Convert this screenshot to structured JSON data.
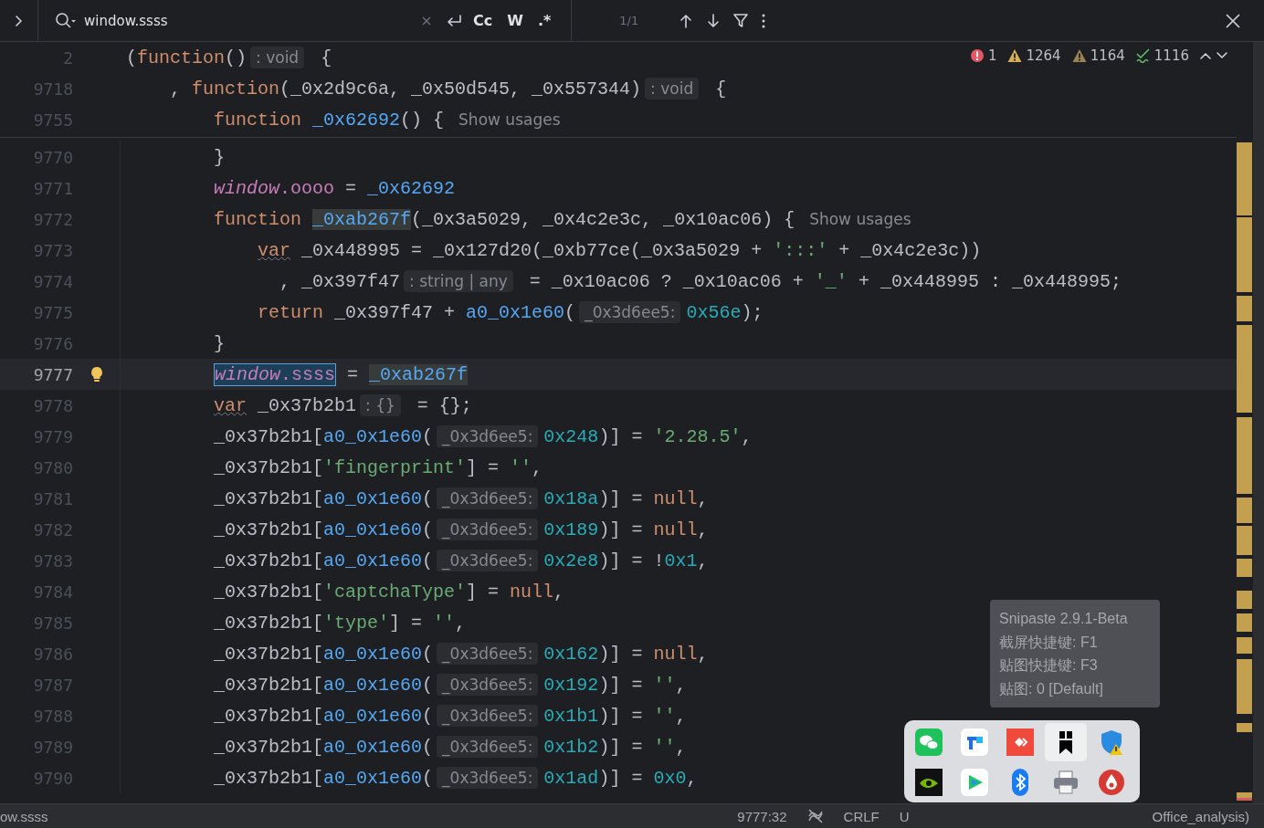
{
  "find_bar": {
    "query": "window.ssss",
    "options": [
      {
        "label": "Cc",
        "selected": false
      },
      {
        "label": "W",
        "selected": false
      },
      {
        "label": ".*",
        "selected": false
      }
    ],
    "count": "1/1"
  },
  "inspections": [
    {
      "kind": "error",
      "count": "1"
    },
    {
      "kind": "warning",
      "count": "1264"
    },
    {
      "kind": "weak",
      "count": "1164"
    },
    {
      "kind": "typo",
      "count": "1116"
    }
  ],
  "sticky_lines": [
    {
      "number": "2",
      "tokens": [
        {
          "kind": "plain",
          "text": "("
        },
        {
          "kind": "kw",
          "text": "function"
        },
        {
          "kind": "plain",
          "text": "()"
        },
        {
          "kind": "hint",
          "text": ": void"
        },
        {
          "kind": "plain",
          "text": " {"
        }
      ]
    },
    {
      "number": "9718",
      "tokens": [
        {
          "kind": "plain",
          "text": "    , "
        },
        {
          "kind": "kw",
          "text": "function"
        },
        {
          "kind": "plain",
          "text": "(_0x2d9c6a, _0x50d545, _0x557344)"
        },
        {
          "kind": "hint",
          "text": ": void"
        },
        {
          "kind": "plain",
          "text": " {"
        }
      ]
    },
    {
      "number": "9755",
      "tokens": [
        {
          "kind": "kw",
          "text": "        function "
        },
        {
          "kind": "decl",
          "text": "_0x62692"
        },
        {
          "kind": "plain",
          "text": "() { "
        },
        {
          "kind": "usage",
          "text": "Show usages"
        }
      ]
    }
  ],
  "lines": [
    {
      "number": "9770",
      "current": false,
      "tokens": [
        {
          "kind": "plain",
          "text": "        }"
        }
      ]
    },
    {
      "number": "9771",
      "current": false,
      "tokens": [
        {
          "kind": "global",
          "text": "        window"
        },
        {
          "kind": "prop",
          "text": ".oooo"
        },
        {
          "kind": "plain",
          "text": " = "
        },
        {
          "kind": "decl",
          "text": "_0x62692"
        }
      ]
    },
    {
      "number": "9772",
      "current": false,
      "tokens": [
        {
          "kind": "kw",
          "text": "        function "
        },
        {
          "kind": "decl",
          "text": "_0xab267f",
          "usage_match": true
        },
        {
          "kind": "plain",
          "text": "(_0x3a5029, _0x4c2e3c, _0x10ac06) { "
        },
        {
          "kind": "usage",
          "text": "Show usages"
        }
      ]
    },
    {
      "number": "9773",
      "current": false,
      "tokens": [
        {
          "kind": "kw",
          "text": "            var",
          "warning": true
        },
        {
          "kind": "plain",
          "text": " _0x448995 = _0x127d20(_0xb77ce(_0x3a5029 + "
        },
        {
          "kind": "str",
          "text": "':::'"
        },
        {
          "kind": "plain",
          "text": " + _0x4c2e3c))"
        }
      ]
    },
    {
      "number": "9774",
      "current": false,
      "tokens": [
        {
          "kind": "plain",
          "text": "              , _0x397f47"
        },
        {
          "kind": "hint",
          "text": ": string | any"
        },
        {
          "kind": "plain",
          "text": " = _0x10ac06 ? _0x10ac06 + "
        },
        {
          "kind": "str",
          "text": "'_'"
        },
        {
          "kind": "plain",
          "text": " + _0x448995 : _0x448995;"
        }
      ]
    },
    {
      "number": "9775",
      "current": false,
      "tokens": [
        {
          "kind": "kw",
          "text": "            return"
        },
        {
          "kind": "plain",
          "text": " _0x397f47 + "
        },
        {
          "kind": "call",
          "text": "a0_0x1e60"
        },
        {
          "kind": "plain",
          "text": "("
        },
        {
          "kind": "hint",
          "text": "_0x3d6ee5:"
        },
        {
          "kind": "num",
          "text": "0x56e"
        },
        {
          "kind": "plain",
          "text": ");"
        }
      ]
    },
    {
      "number": "9776",
      "current": false,
      "tokens": [
        {
          "kind": "plain",
          "text": "        }"
        }
      ]
    },
    {
      "number": "9777",
      "current": true,
      "tokens": [
        {
          "kind": "global",
          "text": "        window",
          "search_match": true
        },
        {
          "kind": "prop",
          "text": ".ssss",
          "search_match": true
        },
        {
          "kind": "plain",
          "text": " = "
        },
        {
          "kind": "decl",
          "text": "_0xab267f",
          "usage_match": true
        }
      ]
    },
    {
      "number": "9778",
      "current": false,
      "tokens": [
        {
          "kind": "kw",
          "text": "        var",
          "warning": true
        },
        {
          "kind": "plain",
          "text": " _0x37b2b1"
        },
        {
          "kind": "hint",
          "text": ": {}"
        },
        {
          "kind": "plain",
          "text": " = {};"
        }
      ]
    },
    {
      "number": "9779",
      "current": false,
      "tokens": [
        {
          "kind": "plain",
          "text": "        _0x37b2b1["
        },
        {
          "kind": "call",
          "text": "a0_0x1e60"
        },
        {
          "kind": "plain",
          "text": "("
        },
        {
          "kind": "hint",
          "text": "_0x3d6ee5:"
        },
        {
          "kind": "num",
          "text": "0x248"
        },
        {
          "kind": "plain",
          "text": ")] = "
        },
        {
          "kind": "str",
          "text": "'2.28.5'"
        },
        {
          "kind": "plain",
          "text": ","
        }
      ]
    },
    {
      "number": "9780",
      "current": false,
      "tokens": [
        {
          "kind": "plain",
          "text": "        _0x37b2b1["
        },
        {
          "kind": "str",
          "text": "'fingerprint'"
        },
        {
          "kind": "plain",
          "text": "] = "
        },
        {
          "kind": "str",
          "text": "''"
        },
        {
          "kind": "plain",
          "text": ","
        }
      ]
    },
    {
      "number": "9781",
      "current": false,
      "tokens": [
        {
          "kind": "plain",
          "text": "        _0x37b2b1["
        },
        {
          "kind": "call",
          "text": "a0_0x1e60"
        },
        {
          "kind": "plain",
          "text": "("
        },
        {
          "kind": "hint",
          "text": "_0x3d6ee5:"
        },
        {
          "kind": "num",
          "text": "0x18a"
        },
        {
          "kind": "plain",
          "text": ")] = "
        },
        {
          "kind": "kw",
          "text": "null"
        },
        {
          "kind": "plain",
          "text": ","
        }
      ]
    },
    {
      "number": "9782",
      "current": false,
      "tokens": [
        {
          "kind": "plain",
          "text": "        _0x37b2b1["
        },
        {
          "kind": "call",
          "text": "a0_0x1e60"
        },
        {
          "kind": "plain",
          "text": "("
        },
        {
          "kind": "hint",
          "text": "_0x3d6ee5:"
        },
        {
          "kind": "num",
          "text": "0x189"
        },
        {
          "kind": "plain",
          "text": ")] = "
        },
        {
          "kind": "kw",
          "text": "null"
        },
        {
          "kind": "plain",
          "text": ","
        }
      ]
    },
    {
      "number": "9783",
      "current": false,
      "tokens": [
        {
          "kind": "plain",
          "text": "        _0x37b2b1["
        },
        {
          "kind": "call",
          "text": "a0_0x1e60"
        },
        {
          "kind": "plain",
          "text": "("
        },
        {
          "kind": "hint",
          "text": "_0x3d6ee5:"
        },
        {
          "kind": "num",
          "text": "0x2e8"
        },
        {
          "kind": "plain",
          "text": ")] = !"
        },
        {
          "kind": "num",
          "text": "0x1"
        },
        {
          "kind": "plain",
          "text": ","
        }
      ]
    },
    {
      "number": "9784",
      "current": false,
      "tokens": [
        {
          "kind": "plain",
          "text": "        _0x37b2b1["
        },
        {
          "kind": "str",
          "text": "'captchaType'"
        },
        {
          "kind": "plain",
          "text": "] = "
        },
        {
          "kind": "kw",
          "text": "null"
        },
        {
          "kind": "plain",
          "text": ","
        }
      ]
    },
    {
      "number": "9785",
      "current": false,
      "tokens": [
        {
          "kind": "plain",
          "text": "        _0x37b2b1["
        },
        {
          "kind": "str",
          "text": "'type'"
        },
        {
          "kind": "plain",
          "text": "] = "
        },
        {
          "kind": "str",
          "text": "''"
        },
        {
          "kind": "plain",
          "text": ","
        }
      ]
    },
    {
      "number": "9786",
      "current": false,
      "tokens": [
        {
          "kind": "plain",
          "text": "        _0x37b2b1["
        },
        {
          "kind": "call",
          "text": "a0_0x1e60"
        },
        {
          "kind": "plain",
          "text": "("
        },
        {
          "kind": "hint",
          "text": "_0x3d6ee5:"
        },
        {
          "kind": "num",
          "text": "0x162"
        },
        {
          "kind": "plain",
          "text": ")] = "
        },
        {
          "kind": "kw",
          "text": "null"
        },
        {
          "kind": "plain",
          "text": ","
        }
      ]
    },
    {
      "number": "9787",
      "current": false,
      "tokens": [
        {
          "kind": "plain",
          "text": "        _0x37b2b1["
        },
        {
          "kind": "call",
          "text": "a0_0x1e60"
        },
        {
          "kind": "plain",
          "text": "("
        },
        {
          "kind": "hint",
          "text": "_0x3d6ee5:"
        },
        {
          "kind": "num",
          "text": "0x192"
        },
        {
          "kind": "plain",
          "text": ")] = "
        },
        {
          "kind": "str",
          "text": "''"
        },
        {
          "kind": "plain",
          "text": ","
        }
      ]
    },
    {
      "number": "9788",
      "current": false,
      "tokens": [
        {
          "kind": "plain",
          "text": "        _0x37b2b1["
        },
        {
          "kind": "call",
          "text": "a0_0x1e60"
        },
        {
          "kind": "plain",
          "text": "("
        },
        {
          "kind": "hint",
          "text": "_0x3d6ee5:"
        },
        {
          "kind": "num",
          "text": "0x1b1"
        },
        {
          "kind": "plain",
          "text": ")] = "
        },
        {
          "kind": "str",
          "text": "''"
        },
        {
          "kind": "plain",
          "text": ","
        }
      ]
    },
    {
      "number": "9789",
      "current": false,
      "tokens": [
        {
          "kind": "plain",
          "text": "        _0x37b2b1["
        },
        {
          "kind": "call",
          "text": "a0_0x1e60"
        },
        {
          "kind": "plain",
          "text": "("
        },
        {
          "kind": "hint",
          "text": "_0x3d6ee5:"
        },
        {
          "kind": "num",
          "text": "0x1b2"
        },
        {
          "kind": "plain",
          "text": ")] = "
        },
        {
          "kind": "str",
          "text": "''"
        },
        {
          "kind": "plain",
          "text": ","
        }
      ]
    },
    {
      "number": "9790",
      "current": false,
      "tokens": [
        {
          "kind": "plain",
          "text": "        _0x37b2b1["
        },
        {
          "kind": "call",
          "text": "a0_0x1e60"
        },
        {
          "kind": "plain",
          "text": "("
        },
        {
          "kind": "hint",
          "text": "_0x3d6ee5:"
        },
        {
          "kind": "num",
          "text": "0x1ad"
        },
        {
          "kind": "plain",
          "text": ")] = "
        },
        {
          "kind": "num",
          "text": "0x0"
        },
        {
          "kind": "plain",
          "text": ","
        }
      ]
    }
  ],
  "status_bar": {
    "left": "ow.ssss",
    "items": [
      {
        "kind": "text",
        "text": "9777:32"
      },
      {
        "kind": "icon"
      },
      {
        "kind": "text",
        "text": "CRLF"
      },
      {
        "kind": "text",
        "text": "U"
      },
      {
        "kind": "far",
        "text": "Office_analysis)"
      }
    ]
  },
  "tooltip": {
    "lines": [
      "Snipaste 2.9.1-Beta",
      "截屏快捷键: F1",
      "贴图快捷键: F3",
      "贴图: 0 [Default]"
    ]
  },
  "tray": [
    {
      "kind": "chat",
      "selected": false
    },
    {
      "kind": "tiles",
      "selected": false
    },
    {
      "kind": "diamond",
      "selected": false
    },
    {
      "kind": "bookmark",
      "selected": true
    },
    {
      "kind": "shield",
      "selected": false
    },
    {
      "kind": "green",
      "selected": false
    },
    {
      "kind": "play",
      "selected": false
    },
    {
      "kind": "bluetooth",
      "selected": false
    },
    {
      "kind": "printer",
      "selected": false
    },
    {
      "kind": "drop",
      "selected": false
    }
  ]
}
